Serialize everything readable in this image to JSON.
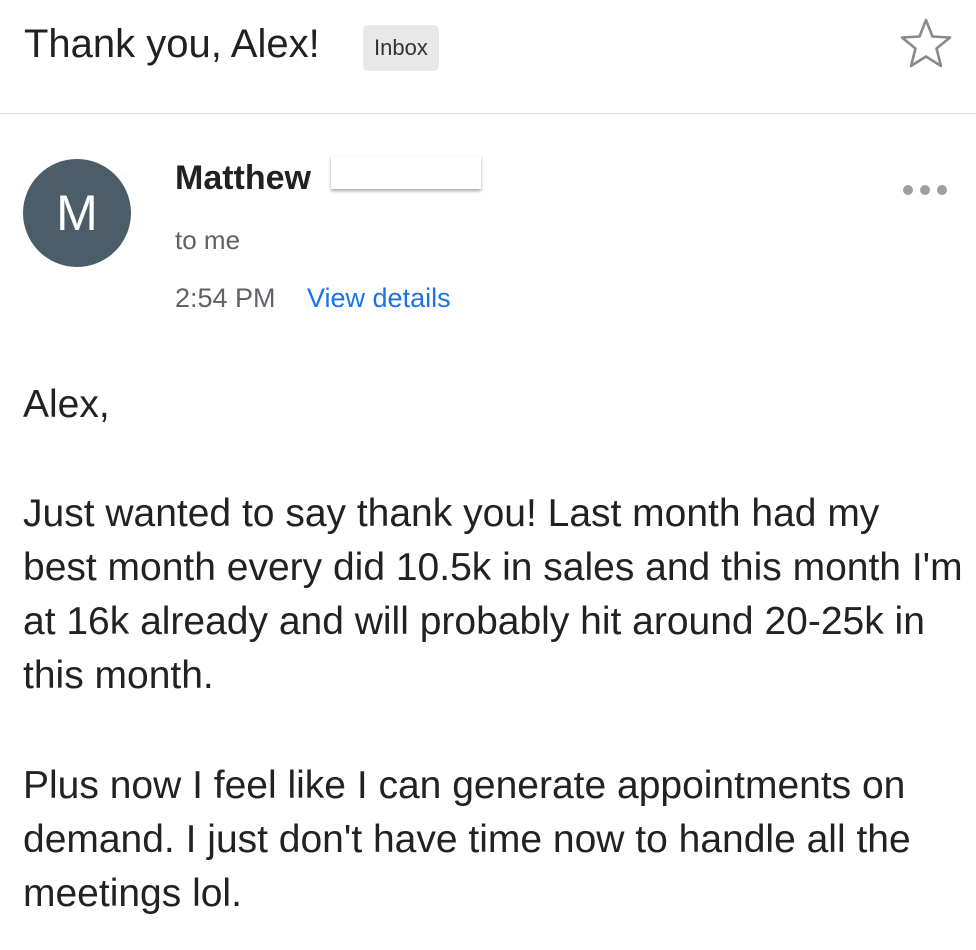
{
  "header": {
    "subject": "Thank you, Alex!",
    "label": "Inbox",
    "star_icon": "star-outline-icon"
  },
  "message": {
    "avatar_initial": "M",
    "avatar_color": "#4b5d68",
    "sender_name": "Matthew",
    "recipient": "to me",
    "time": "2:54 PM",
    "view_details": "View details",
    "more_icon": "more-horizontal-icon",
    "link_color": "#1a73e8",
    "body": {
      "greeting": "Alex,",
      "paragraph1": "Just wanted to say thank you! Last month had my best month every did 10.5k in sales and this month I'm at 16k already and will probably hit around 20-25k in this month.",
      "paragraph2": "Plus now I feel like I can generate appointments on demand. I just don't have time now to handle all the meetings lol."
    }
  }
}
